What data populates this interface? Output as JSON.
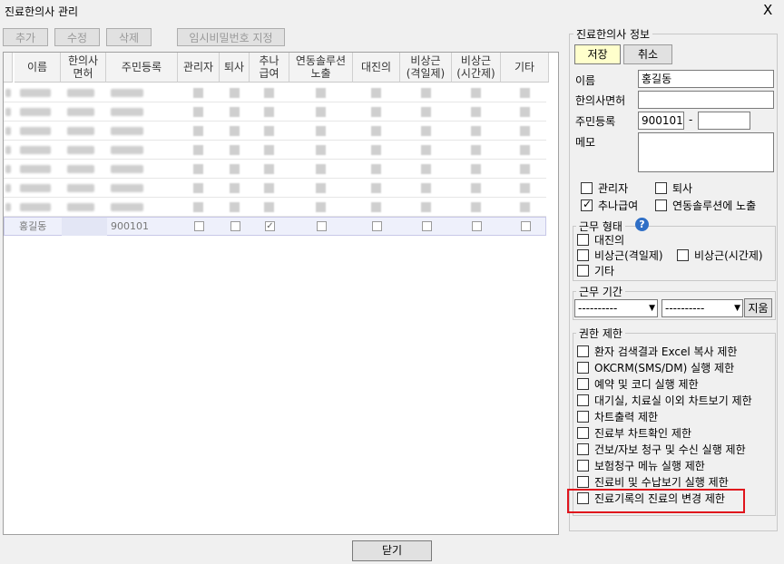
{
  "window": {
    "title": "진료한의사 관리",
    "close": "X"
  },
  "toolbar": {
    "add": "추가",
    "edit": "수정",
    "delete": "삭제",
    "temp_password": "임시비밀번호 지정"
  },
  "grid": {
    "columns": [
      "이름",
      "한의사\n면허",
      "주민등록",
      "관리자",
      "퇴사",
      "추나\n급여",
      "연동솔루션\n노출",
      "대진의",
      "비상근\n(격일제)",
      "비상근\n(시간제)",
      "기타"
    ],
    "selected_row": {
      "name": "홍길동",
      "license": "",
      "rrn": "900101",
      "checks": [
        false,
        false,
        true,
        false,
        false,
        false,
        false,
        false
      ]
    }
  },
  "detail": {
    "section_title": "진료한의사 정보",
    "save": "저장",
    "cancel": "취소",
    "name_label": "이름",
    "name_value": "홍길동",
    "license_label": "한의사면허",
    "license_value": "",
    "rrn_label": "주민등록",
    "rrn_front": "900101",
    "rrn_dash": "-",
    "rrn_back": "",
    "memo_label": "메모",
    "admin": "관리자",
    "retired": "퇴사",
    "chuna": "추나급여",
    "linked": "연동솔루션에 노출"
  },
  "work_type": {
    "title": "근무 형태",
    "help": "?",
    "substitute": "대진의",
    "parttime_alt": "비상근(격일제)",
    "parttime_hour": "비상근(시간제)",
    "other": "기타"
  },
  "work_period": {
    "title": "근무 기간",
    "start": "----‐--‐--",
    "end": "----‐--‐--",
    "clear": "지움"
  },
  "permissions": {
    "title": "권한 제한",
    "items": [
      "환자 검색결과 Excel 복사 제한",
      "OKCRM(SMS/DM) 실행 제한",
      "예약 및 코디 실행 제한",
      "대기실, 치료실 이외 차트보기 제한",
      "차트출력 제한",
      "진료부 차트확인 제한",
      "건보/자보 청구 및 수신 실행 제한",
      "보험청구 메뉴 실행 제한",
      "진료비 및 수납보기 실행 제한",
      "진료기록의 진료의 변경 제한"
    ]
  },
  "footer": {
    "close": "닫기"
  },
  "colors": {
    "highlight": "#e0141c",
    "save_btn": "#ffffcc",
    "selected_row": "#eef0fb"
  }
}
